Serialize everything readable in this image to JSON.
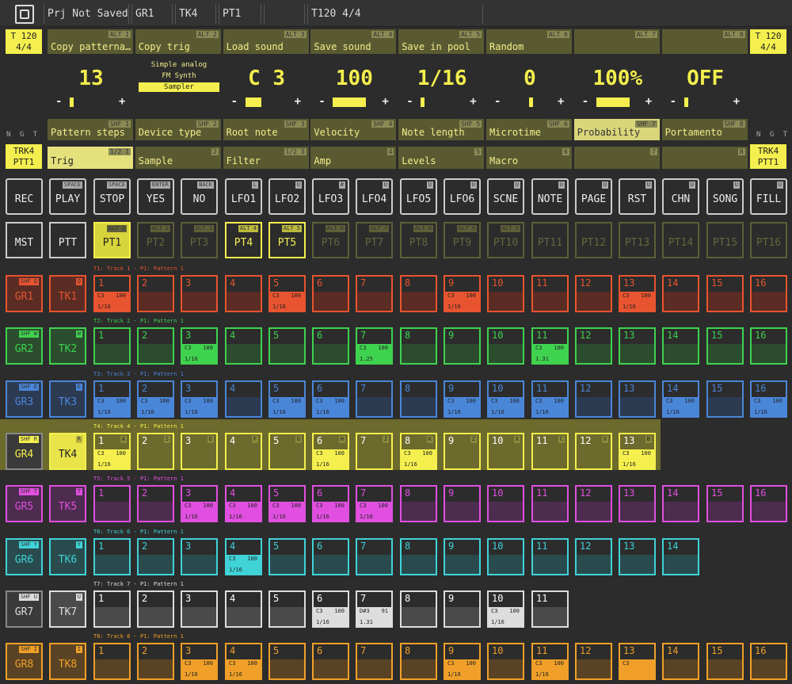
{
  "topbar": {
    "project": "Prj Not Saved",
    "group": "GR1",
    "track": "TK4",
    "pattern": "PT1",
    "blank": "",
    "tempo": "T120 4/4"
  },
  "tempo_box": {
    "line1": "T 120",
    "line2": "4/4"
  },
  "track_box": {
    "line1": "TRK4",
    "line2": "PTT1"
  },
  "ngt": "N G T",
  "alt_menu": [
    {
      "label": "Copy patterna…",
      "key": "ALT 1"
    },
    {
      "label": "Copy trig",
      "key": "ALT 2"
    },
    {
      "label": "Load sound",
      "key": "ALT 3"
    },
    {
      "label": "Save sound",
      "key": "ALT 4"
    },
    {
      "label": "Save in pool",
      "key": "ALT 5"
    },
    {
      "label": "Random",
      "key": "ALT 6"
    },
    {
      "label": "",
      "key": "ALT 7"
    },
    {
      "label": "",
      "key": "ALT 8"
    }
  ],
  "devices": [
    "Simple analog",
    "FM Synth",
    "Sampler"
  ],
  "values": [
    {
      "value": "13",
      "level": 0.0
    },
    {
      "value": "",
      "level": 0.0
    },
    {
      "value": "C 3",
      "level": 0.35
    },
    {
      "value": "100",
      "level": 0.75
    },
    {
      "value": "1/16",
      "level": 0.0
    },
    {
      "value": "0",
      "level": 0.0
    },
    {
      "value": "100%",
      "level": 0.75
    },
    {
      "value": "OFF",
      "level": 0.0
    }
  ],
  "shf_menu": [
    {
      "label": "Pattern steps",
      "key": "SHF 1"
    },
    {
      "label": "Device type",
      "key": "SHF 2"
    },
    {
      "label": "Root note",
      "key": "SHF 3"
    },
    {
      "label": "Velocity",
      "key": "SHF 4"
    },
    {
      "label": "Note length",
      "key": "SHF 5"
    },
    {
      "label": "Microtime",
      "key": "SHF 6"
    },
    {
      "label": "Probability",
      "key": "SHF 7"
    },
    {
      "label": "Portamento",
      "key": "SHF 8"
    }
  ],
  "pages": [
    {
      "label": "Trig",
      "num": "1/2 1"
    },
    {
      "label": "Sample",
      "num": "2"
    },
    {
      "label": "Filter",
      "num": "1/2 3"
    },
    {
      "label": "Amp",
      "num": "4"
    },
    {
      "label": "Levels",
      "num": "5"
    },
    {
      "label": "Macro",
      "num": "6"
    },
    {
      "label": "",
      "num": "7"
    },
    {
      "label": "",
      "num": "8"
    }
  ],
  "control_buttons": [
    {
      "label": "REC",
      "key": ""
    },
    {
      "label": "PLAY",
      "key": "SPACE"
    },
    {
      "label": "STOP",
      "key": "SPACE"
    },
    {
      "label": "YES",
      "key": "ENTER"
    },
    {
      "label": "NO",
      "key": "BACK"
    },
    {
      "label": "LFO1",
      "key": "L"
    },
    {
      "label": "LFO2",
      "key": "U"
    },
    {
      "label": "LFO3",
      "key": "#"
    },
    {
      "label": "LFO4",
      "key": "U"
    },
    {
      "label": "LFO5",
      "key": "U"
    },
    {
      "label": "LFO6",
      "key": "U"
    },
    {
      "label": "SCNE",
      "key": "U"
    },
    {
      "label": "NOTE",
      "key": "U"
    },
    {
      "label": "PAGE",
      "key": "U"
    },
    {
      "label": "RST",
      "key": "U"
    },
    {
      "label": "CHN",
      "key": "U"
    },
    {
      "label": "SONG",
      "key": "U"
    },
    {
      "label": "FILL",
      "key": "U"
    }
  ],
  "mst": "MST",
  "ptt": "PTT",
  "patterns": [
    {
      "label": "PT1",
      "key": "ALT 1"
    },
    {
      "label": "PT2",
      "key": "ALT 2"
    },
    {
      "label": "PT3",
      "key": "ALT 3"
    },
    {
      "label": "PT4",
      "key": "ALT 4"
    },
    {
      "label": "PT5",
      "key": "ALT 5"
    },
    {
      "label": "PT6",
      "key": "ALT 6"
    },
    {
      "label": "PT7",
      "key": "ALT 7"
    },
    {
      "label": "PT8",
      "key": "ALT 8"
    },
    {
      "label": "PT9",
      "key": "ALT 9"
    },
    {
      "label": "PT10",
      "key": "ALT 0"
    },
    {
      "label": "PT11",
      "key": ""
    },
    {
      "label": "PT12",
      "key": ""
    },
    {
      "label": "PT13",
      "key": ""
    },
    {
      "label": "PT14",
      "key": ""
    },
    {
      "label": "PT15",
      "key": ""
    },
    {
      "label": "PT16",
      "key": ""
    }
  ],
  "tracks": [
    {
      "title": "T1: Track 1 - P1: Pattern 1",
      "group": "GR1",
      "gkey": "SHF Q",
      "track": "TK1",
      "tkey": "Q",
      "color": "#e8542f",
      "dark": "#5a2c24",
      "steps": 16,
      "notes": {
        "1": [
          "C3",
          "100",
          "1/16"
        ],
        "5": [
          "C3",
          "100",
          "1/16"
        ],
        "9": [
          "C3",
          "100",
          "1/16"
        ],
        "13": [
          "C3",
          "100",
          "1/16"
        ]
      }
    },
    {
      "title": "T2: Track 2 - P1: Pattern 1",
      "group": "GR2",
      "gkey": "SHF W",
      "track": "TK2",
      "tkey": "W",
      "color": "#3fd24f",
      "dark": "#2b4d2e",
      "steps": 16,
      "notes": {
        "3": [
          "C3",
          "100",
          "1/16"
        ],
        "7": [
          "C3",
          "100",
          "1.25"
        ],
        "11": [
          "C3",
          "100",
          "1.31"
        ]
      }
    },
    {
      "title": "T3: Track 3 - P1: Pattern 1",
      "group": "GR3",
      "gkey": "SHF E",
      "track": "TK3",
      "tkey": "E",
      "color": "#4a86d8",
      "dark": "#2c3a52",
      "steps": 16,
      "notes": {
        "1": [
          "C3",
          "100",
          "1/16"
        ],
        "2": [
          "C3",
          "100",
          "1/16"
        ],
        "3": [
          "C3",
          "100",
          "1/16"
        ],
        "5": [
          "C3",
          "100",
          "1/16"
        ],
        "6": [
          "C3",
          "100",
          "1/16"
        ],
        "9": [
          "C3",
          "100",
          "1/16"
        ],
        "10": [
          "C3",
          "100",
          "1/16"
        ],
        "11": [
          "C3",
          "100",
          "1/16"
        ],
        "14": [
          "C3",
          "100",
          "1/16"
        ],
        "16": [
          "C3",
          "100",
          "1/16"
        ]
      }
    },
    {
      "title": "T4: Track 4 - P1: Pattern 1",
      "group": "GR4",
      "gkey": "SHF R",
      "track": "TK4",
      "tkey": "R",
      "color": "#f4ef4e",
      "dark": "#6c6a2c",
      "steps": 13,
      "keys": {
        "1": "A",
        "2": "S",
        "3": "D",
        "4": "F",
        "5": "G",
        "6": "H",
        "7": "J",
        "8": "K",
        "9": "Z",
        "10": "X",
        "11": "C",
        "12": "V",
        "13": "B"
      },
      "notes": {
        "1": [
          "C3",
          "100",
          "1/16"
        ],
        "6": [
          "C3",
          "100",
          "1/16"
        ],
        "8": [
          "C3",
          "100",
          "1/16"
        ],
        "13": [
          "C3",
          "100",
          "1/16"
        ]
      }
    },
    {
      "title": "T5: Track 5 - P1: Pattern 1",
      "group": "GR5",
      "gkey": "SHF T",
      "track": "TK5",
      "tkey": "T",
      "color": "#e04fe0",
      "dark": "#4d2c4f",
      "steps": 16,
      "notes": {
        "3": [
          "C3",
          "100",
          "1/16"
        ],
        "4": [
          "C3",
          "100",
          "1/16"
        ],
        "5": [
          "C3",
          "100",
          "1/16"
        ],
        "6": [
          "C3",
          "100",
          "1/16"
        ],
        "7": [
          "C3",
          "100",
          "1/16"
        ]
      }
    },
    {
      "title": "T6: Track 6 - P1: Pattern 1",
      "group": "GR6",
      "gkey": "SHF Y",
      "track": "TK6",
      "tkey": "Y",
      "color": "#3fd3d8",
      "dark": "#2a4b4e",
      "steps": 14,
      "notes": {
        "4": [
          "C3",
          "100",
          "1/16"
        ]
      }
    },
    {
      "title": "T7: Track 7 - P1: Pattern 1",
      "group": "GR7",
      "gkey": "SHF U",
      "track": "TK7",
      "tkey": "U",
      "color": "#dddddd",
      "dark": "#4a4a4a",
      "steps": 11,
      "notes": {
        "6": [
          "C3",
          "100",
          "1/16"
        ],
        "7": [
          "D#3",
          "91",
          "1.31"
        ],
        "10": [
          "C3",
          "100",
          "1/16"
        ]
      }
    },
    {
      "title": "T8: Track 8 - P1: Pattern 1",
      "group": "GR8",
      "gkey": "SHF I",
      "track": "TK8",
      "tkey": "I",
      "color": "#f0a028",
      "dark": "#5a4324",
      "steps": 16,
      "notes": {
        "3": [
          "C3",
          "100",
          "1/16"
        ],
        "4": [
          "C3",
          "100",
          "1/16"
        ],
        "9": [
          "C3",
          "100",
          "1/16"
        ],
        "11": [
          "C3",
          "100",
          "1/16"
        ],
        "13": [
          "C3",
          "",
          ""
        ]
      }
    }
  ]
}
